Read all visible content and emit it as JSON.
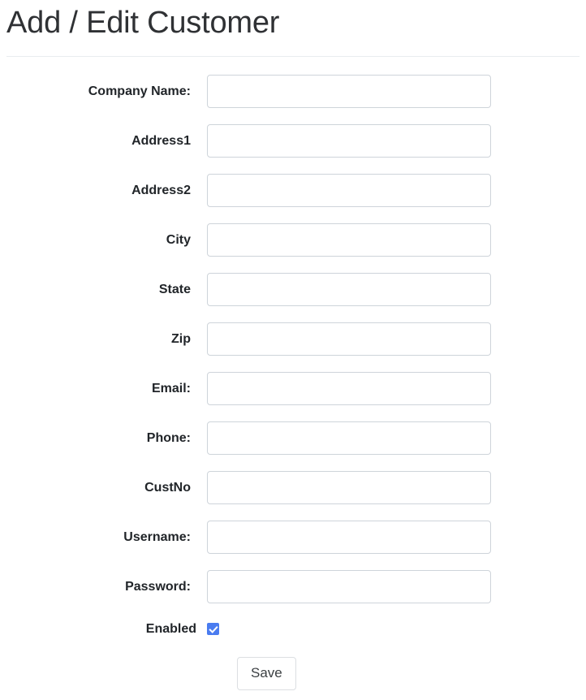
{
  "page": {
    "title": "Add / Edit Customer"
  },
  "form": {
    "fields": [
      {
        "label": "Company Name:",
        "name": "company-name",
        "value": "",
        "placeholder": "",
        "type": "text"
      },
      {
        "label": "Address1",
        "name": "address1",
        "value": "",
        "placeholder": "",
        "type": "text"
      },
      {
        "label": "Address2",
        "name": "address2",
        "value": "",
        "placeholder": "",
        "type": "text"
      },
      {
        "label": "City",
        "name": "city",
        "value": "",
        "placeholder": "",
        "type": "text"
      },
      {
        "label": "State",
        "name": "state",
        "value": "",
        "placeholder": "",
        "type": "text"
      },
      {
        "label": "Zip",
        "name": "zip",
        "value": "",
        "placeholder": "",
        "type": "text"
      },
      {
        "label": "Email:",
        "name": "email",
        "value": "",
        "placeholder": "",
        "type": "text"
      },
      {
        "label": "Phone:",
        "name": "phone",
        "value": "",
        "placeholder": "",
        "type": "text"
      },
      {
        "label": "CustNo",
        "name": "custno",
        "value": "",
        "placeholder": "",
        "type": "text"
      },
      {
        "label": "Username:",
        "name": "username",
        "value": "",
        "placeholder": "",
        "type": "text"
      },
      {
        "label": "Password:",
        "name": "password",
        "value": "",
        "placeholder": "",
        "type": "text"
      }
    ],
    "enabled": {
      "label": "Enabled",
      "checked": true
    },
    "save_label": "Save"
  },
  "colors": {
    "checkbox_accent": "#4a7cf0",
    "input_border": "#ced4da",
    "title_text": "#2f3134",
    "divider": "#e9ecef"
  }
}
